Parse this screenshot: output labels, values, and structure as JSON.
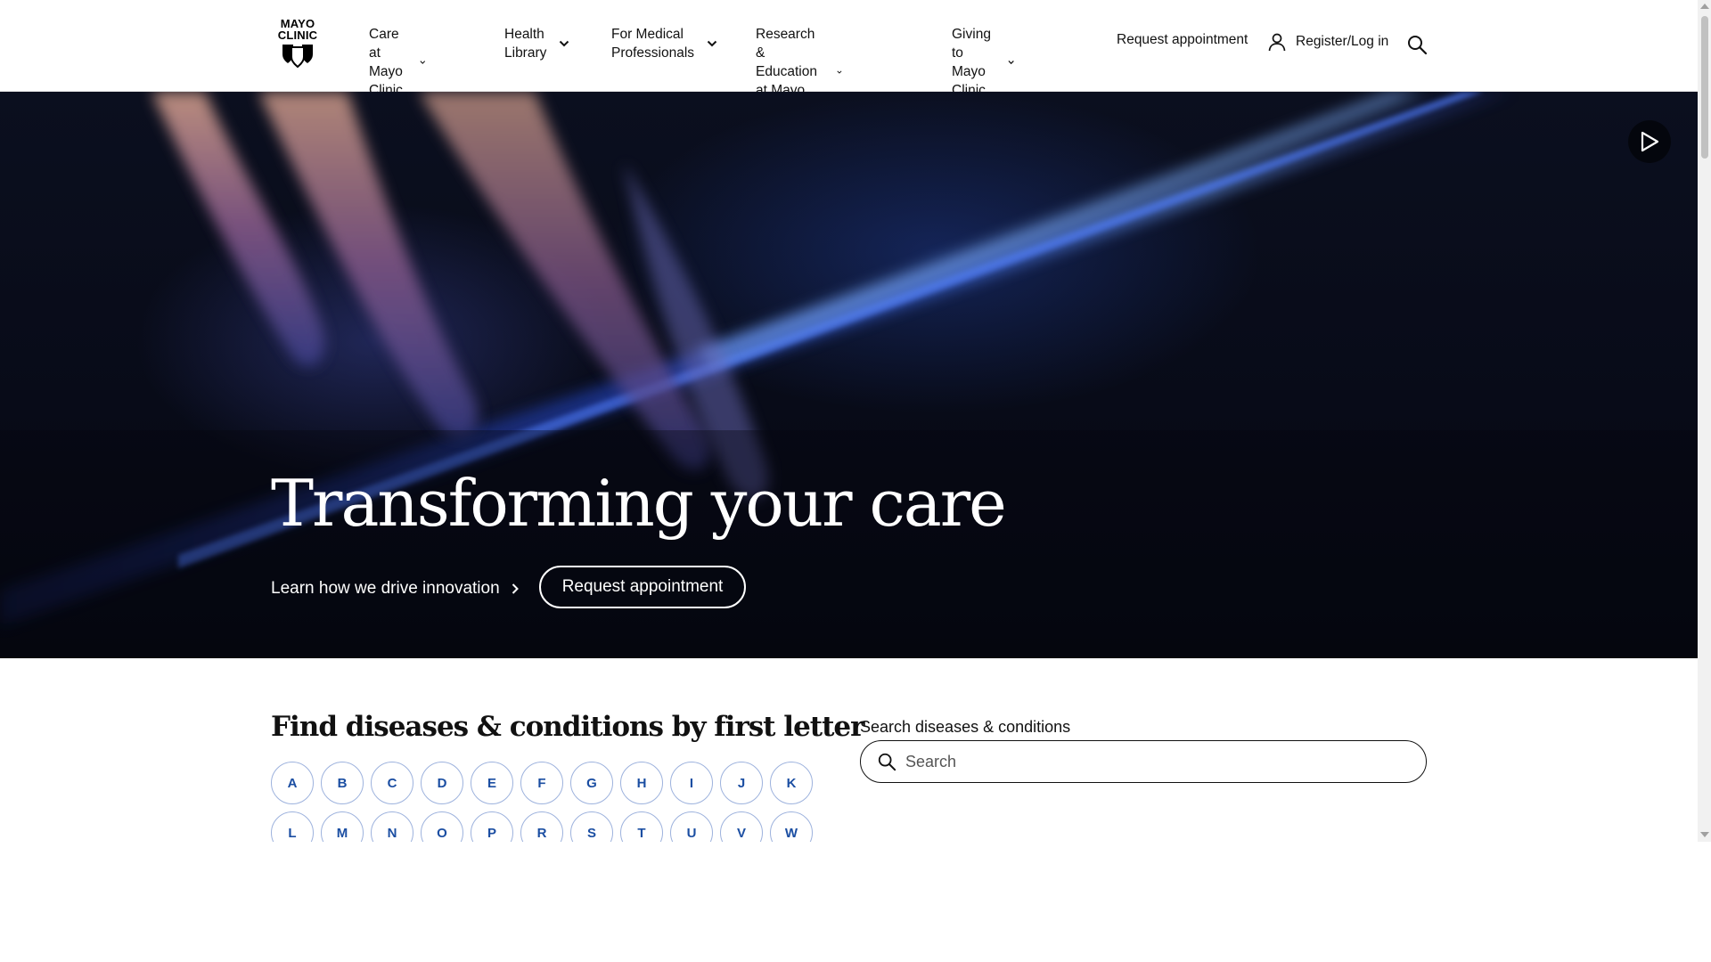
{
  "header": {
    "logo": {
      "line1": "MAYO",
      "line2": "CLINIC",
      "icon": "mayo-shields-icon"
    },
    "nav": [
      {
        "label": "Care at\nMayo Clinic"
      },
      {
        "label": "Health\nLibrary"
      },
      {
        "label": "For Medical\nProfessionals"
      },
      {
        "label": "Research & Education\nat Mayo Clinic"
      },
      {
        "label": "Giving to\nMayo Clinic"
      }
    ],
    "request_appointment": "Request appointment",
    "register_login": "Register/Log in",
    "search_icon": "search-icon",
    "user_icon": "user-icon"
  },
  "hero": {
    "title": "Transforming your care",
    "link_label": "Learn how we drive innovation",
    "button_label": "Request appointment",
    "play_icon": "play-icon"
  },
  "diseases": {
    "title": "Find diseases & conditions by first letter",
    "letters_row1": [
      "A",
      "B",
      "C",
      "D",
      "E",
      "F",
      "G",
      "H",
      "I",
      "J",
      "K"
    ],
    "letters_row2": [
      "L",
      "M",
      "N",
      "O",
      "P",
      "R",
      "S",
      "T",
      "U",
      "V",
      "W"
    ],
    "search_label": "Search diseases & conditions",
    "search_placeholder": "Search"
  },
  "colors": {
    "letter_text": "#1b4ea2",
    "letter_border": "#9db2dd",
    "hero_bg": "#080b18"
  }
}
